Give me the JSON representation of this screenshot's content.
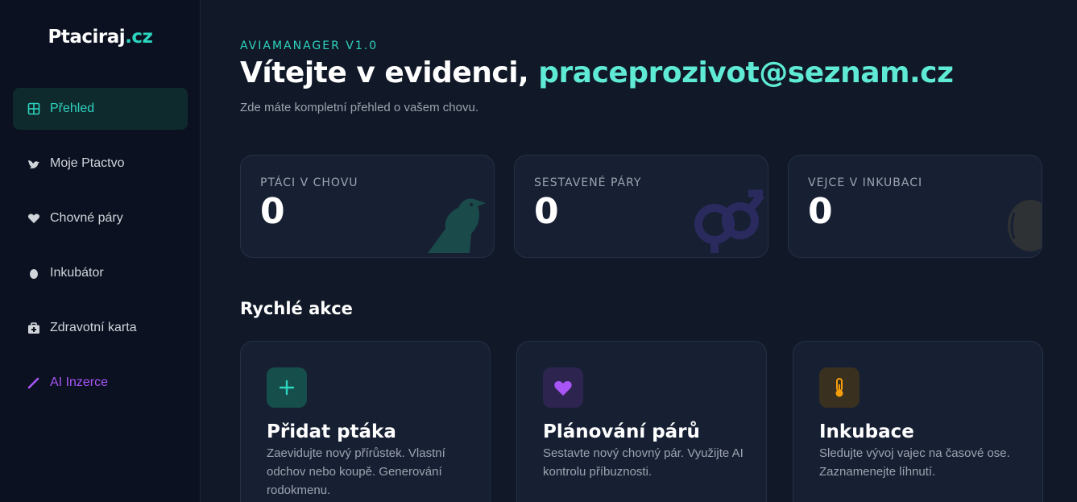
{
  "sidebar": {
    "logo_main": "Ptaciraj",
    "logo_tld": ".cz",
    "items": [
      {
        "label": "Přehled",
        "icon": "dashboard-icon"
      },
      {
        "label": "Moje Ptactvo",
        "icon": "bird-icon"
      },
      {
        "label": "Chovné páry",
        "icon": "heart-icon"
      },
      {
        "label": "Inkubátor",
        "icon": "egg-icon"
      },
      {
        "label": "Zdravotní karta",
        "icon": "medical-kit-icon"
      },
      {
        "label": "AI Inzerce",
        "icon": "magic-wand-icon"
      }
    ]
  },
  "header": {
    "eyebrow": "AVIAMANAGER V1.0",
    "welcome": "Vítejte v evidenci, ",
    "email": "praceprozivot@seznam.cz",
    "subtitle": "Zde máte kompletní přehled o vašem chovu."
  },
  "stats": [
    {
      "label": "PTÁCI V CHOVU",
      "value": "0",
      "icon": "crow-icon"
    },
    {
      "label": "SESTAVENÉ PÁRY",
      "value": "0",
      "icon": "gender-icon"
    },
    {
      "label": "VEJCE V INKUBACI",
      "value": "0",
      "icon": "egg-icon"
    }
  ],
  "quick_actions": {
    "title": "Rychlé akce",
    "items": [
      {
        "title": "Přidat ptáka",
        "description": "Zaevidujte nový přírůstek. Vlastní odchov nebo koupě. Generování rodokmenu.",
        "icon": "plus-icon"
      },
      {
        "title": "Plánování párů",
        "description": "Sestavte nový chovný pár. Využijte AI kontrolu příbuznosti.",
        "icon": "heart-icon"
      },
      {
        "title": "Inkubace",
        "description": "Sledujte vývoj vajec na časové ose. Zaznamenejte líhnutí.",
        "icon": "thermometer-icon"
      }
    ]
  },
  "colors": {
    "accent": "#2dd4bf",
    "purple": "#a855f7",
    "amber": "#f59e0b",
    "background": "#111827",
    "sidebar": "#0b1120",
    "card": "#172033"
  }
}
